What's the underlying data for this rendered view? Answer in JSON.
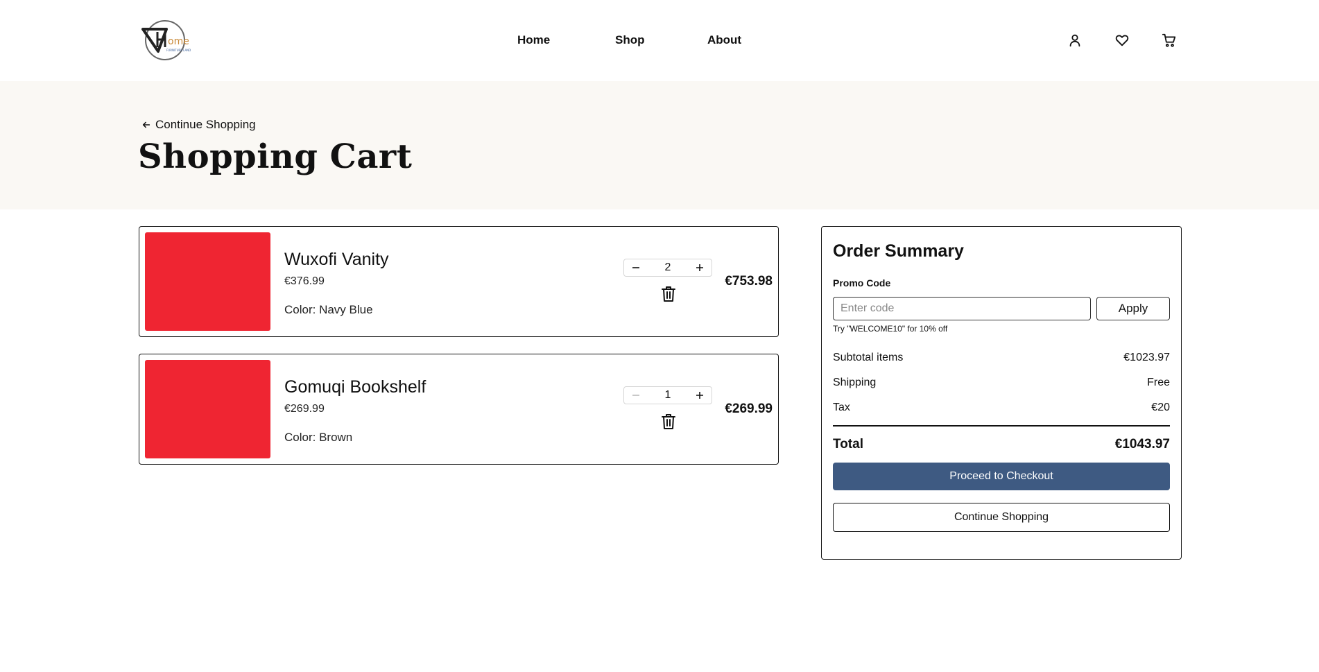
{
  "header": {
    "logo_text": "Home",
    "logo_subtext": "FURNITURE LAND",
    "nav": [
      {
        "label": "Home"
      },
      {
        "label": "Shop"
      },
      {
        "label": "About"
      }
    ],
    "icons": [
      "user-icon",
      "heart-icon",
      "cart-icon"
    ]
  },
  "hero": {
    "back_label": "Continue Shopping",
    "title": "Shopping Cart"
  },
  "cart": {
    "items": [
      {
        "name": "Wuxofi Vanity",
        "unit_price": "€376.99",
        "color": "Color: Navy Blue",
        "quantity": "2",
        "total": "€753.98",
        "image_color": "#ef2532"
      },
      {
        "name": "Gomuqi Bookshelf",
        "unit_price": "€269.99",
        "color": "Color: Brown",
        "quantity": "1",
        "total": "€269.99",
        "image_color": "#ef2532"
      }
    ]
  },
  "summary": {
    "title": "Order Summary",
    "promo_label": "Promo Code",
    "promo_placeholder": "Enter code",
    "promo_value": "",
    "apply_label": "Apply",
    "promo_hint": "Try \"WELCOME10\" for 10% off",
    "subtotal_label": "Subtotal items",
    "subtotal_value": "€1023.97",
    "shipping_label": "Shipping",
    "shipping_value": "Free",
    "tax_label": "Tax",
    "tax_value": "€20",
    "total_label": "Total",
    "total_value": "€1043.97",
    "checkout_label": "Proceed to Checkout",
    "continue_label": "Continue Shopping"
  },
  "colors": {
    "accent": "#3e5a82",
    "hero_bg": "#faf8f4",
    "placeholder_image": "#ef2532"
  }
}
